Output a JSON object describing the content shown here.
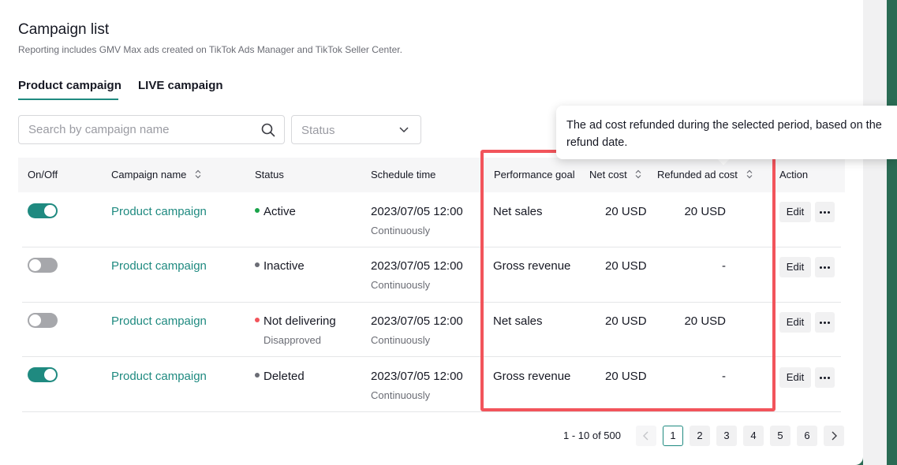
{
  "header": {
    "title": "Campaign list",
    "subtitle": "Reporting includes GMV Max ads created on TikTok Ads Manager and TikTok Seller Center."
  },
  "tabs": [
    {
      "label": "Product campaign",
      "active": true
    },
    {
      "label": "LIVE campaign",
      "active": false
    }
  ],
  "filters": {
    "search_placeholder": "Search by campaign name",
    "status_placeholder": "Status"
  },
  "tooltip": {
    "text": "The ad cost refunded during the selected period, based on the refund date."
  },
  "table": {
    "columns": {
      "onoff": "On/Off",
      "name": "Campaign name",
      "status": "Status",
      "schedule": "Schedule time",
      "goal": "Performance goal",
      "net_cost": "Net cost",
      "refunded": "Refunded ad cost",
      "action": "Action"
    },
    "rows": [
      {
        "on": true,
        "name": "Product campaign",
        "status": "Active",
        "status_color": "#1aa34a",
        "substatus": "",
        "schedule": "2023/07/05 12:00",
        "schedule_sub": "Continuously",
        "goal": "Net sales",
        "net_cost": "20 USD",
        "refunded": "20 USD",
        "edit": "Edit"
      },
      {
        "on": false,
        "name": "Product campaign",
        "status": "Inactive",
        "status_color": "#6b6d75",
        "substatus": "",
        "schedule": "2023/07/05 12:00",
        "schedule_sub": "Continuously",
        "goal": "Gross revenue",
        "net_cost": "20 USD",
        "refunded": "-",
        "edit": "Edit"
      },
      {
        "on": false,
        "name": "Product campaign",
        "status": "Not delivering",
        "status_color": "#f2545b",
        "substatus": "Disapproved",
        "schedule": "2023/07/05 12:00",
        "schedule_sub": "Continuously",
        "goal": "Net sales",
        "net_cost": "20 USD",
        "refunded": "20 USD",
        "edit": "Edit"
      },
      {
        "on": true,
        "name": "Product campaign",
        "status": "Deleted",
        "status_color": "#6b6d75",
        "substatus": "",
        "schedule": "2023/07/05 12:00",
        "schedule_sub": "Continuously",
        "goal": "Gross revenue",
        "net_cost": "20 USD",
        "refunded": "-",
        "edit": "Edit"
      }
    ]
  },
  "pagination": {
    "total": "1 - 10 of 500",
    "pages": [
      "1",
      "2",
      "3",
      "4",
      "5",
      "6"
    ],
    "current": "1"
  },
  "colors": {
    "accent": "#1f8a80",
    "highlight": "#f2545b",
    "background": "#2a6b54"
  }
}
